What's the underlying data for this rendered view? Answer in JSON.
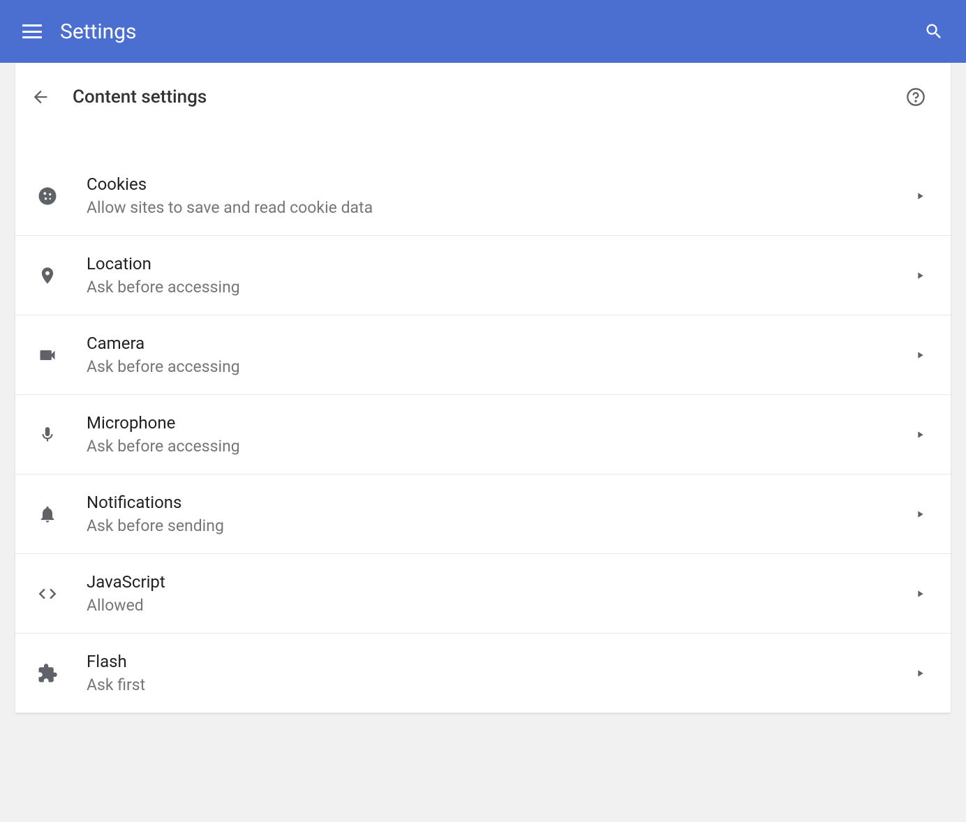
{
  "header": {
    "title": "Settings"
  },
  "page": {
    "title": "Content settings"
  },
  "items": [
    {
      "title": "Cookies",
      "subtitle": "Allow sites to save and read cookie data",
      "icon": "cookie"
    },
    {
      "title": "Location",
      "subtitle": "Ask before accessing",
      "icon": "location"
    },
    {
      "title": "Camera",
      "subtitle": "Ask before accessing",
      "icon": "camera"
    },
    {
      "title": "Microphone",
      "subtitle": "Ask before accessing",
      "icon": "microphone"
    },
    {
      "title": "Notifications",
      "subtitle": "Ask before sending",
      "icon": "bell"
    },
    {
      "title": "JavaScript",
      "subtitle": "Allowed",
      "icon": "code"
    },
    {
      "title": "Flash",
      "subtitle": "Ask first",
      "icon": "puzzle"
    }
  ]
}
